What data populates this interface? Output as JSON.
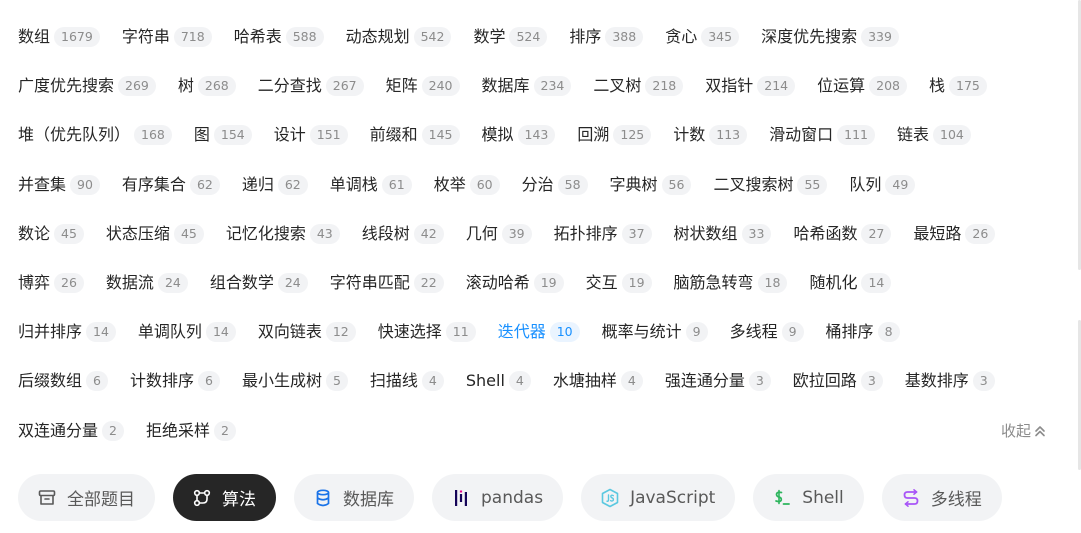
{
  "tag_rows": [
    [
      {
        "label": "数组",
        "count": "1679"
      },
      {
        "label": "字符串",
        "count": "718"
      },
      {
        "label": "哈希表",
        "count": "588"
      },
      {
        "label": "动态规划",
        "count": "542"
      },
      {
        "label": "数学",
        "count": "524"
      },
      {
        "label": "排序",
        "count": "388"
      },
      {
        "label": "贪心",
        "count": "345"
      },
      {
        "label": "深度优先搜索",
        "count": "339"
      }
    ],
    [
      {
        "label": "广度优先搜索",
        "count": "269"
      },
      {
        "label": "树",
        "count": "268"
      },
      {
        "label": "二分查找",
        "count": "267"
      },
      {
        "label": "矩阵",
        "count": "240"
      },
      {
        "label": "数据库",
        "count": "234"
      },
      {
        "label": "二叉树",
        "count": "218"
      },
      {
        "label": "双指针",
        "count": "214"
      },
      {
        "label": "位运算",
        "count": "208"
      },
      {
        "label": "栈",
        "count": "175"
      }
    ],
    [
      {
        "label": "堆（优先队列）",
        "count": "168"
      },
      {
        "label": "图",
        "count": "154"
      },
      {
        "label": "设计",
        "count": "151"
      },
      {
        "label": "前缀和",
        "count": "145"
      },
      {
        "label": "模拟",
        "count": "143"
      },
      {
        "label": "回溯",
        "count": "125"
      },
      {
        "label": "计数",
        "count": "113"
      },
      {
        "label": "滑动窗口",
        "count": "111"
      },
      {
        "label": "链表",
        "count": "104"
      }
    ],
    [
      {
        "label": "并查集",
        "count": "90"
      },
      {
        "label": "有序集合",
        "count": "62"
      },
      {
        "label": "递归",
        "count": "62"
      },
      {
        "label": "单调栈",
        "count": "61"
      },
      {
        "label": "枚举",
        "count": "60"
      },
      {
        "label": "分治",
        "count": "58"
      },
      {
        "label": "字典树",
        "count": "56"
      },
      {
        "label": "二叉搜索树",
        "count": "55"
      },
      {
        "label": "队列",
        "count": "49"
      }
    ],
    [
      {
        "label": "数论",
        "count": "45"
      },
      {
        "label": "状态压缩",
        "count": "45"
      },
      {
        "label": "记忆化搜索",
        "count": "43"
      },
      {
        "label": "线段树",
        "count": "42"
      },
      {
        "label": "几何",
        "count": "39"
      },
      {
        "label": "拓扑排序",
        "count": "37"
      },
      {
        "label": "树状数组",
        "count": "33"
      },
      {
        "label": "哈希函数",
        "count": "27"
      },
      {
        "label": "最短路",
        "count": "26"
      }
    ],
    [
      {
        "label": "博弈",
        "count": "26"
      },
      {
        "label": "数据流",
        "count": "24"
      },
      {
        "label": "组合数学",
        "count": "24"
      },
      {
        "label": "字符串匹配",
        "count": "22"
      },
      {
        "label": "滚动哈希",
        "count": "19"
      },
      {
        "label": "交互",
        "count": "19"
      },
      {
        "label": "脑筋急转弯",
        "count": "18"
      },
      {
        "label": "随机化",
        "count": "14"
      }
    ],
    [
      {
        "label": "归并排序",
        "count": "14"
      },
      {
        "label": "单调队列",
        "count": "14"
      },
      {
        "label": "双向链表",
        "count": "12"
      },
      {
        "label": "快速选择",
        "count": "11"
      },
      {
        "label": "迭代器",
        "count": "10",
        "selected": true
      },
      {
        "label": "概率与统计",
        "count": "9"
      },
      {
        "label": "多线程",
        "count": "9"
      },
      {
        "label": "桶排序",
        "count": "8"
      }
    ],
    [
      {
        "label": "后缀数组",
        "count": "6"
      },
      {
        "label": "计数排序",
        "count": "6"
      },
      {
        "label": "最小生成树",
        "count": "5"
      },
      {
        "label": "扫描线",
        "count": "4"
      },
      {
        "label": "Shell",
        "count": "4"
      },
      {
        "label": "水塘抽样",
        "count": "4"
      },
      {
        "label": "强连通分量",
        "count": "3"
      },
      {
        "label": "欧拉回路",
        "count": "3"
      },
      {
        "label": "基数排序",
        "count": "3"
      }
    ],
    [
      {
        "label": "双连通分量",
        "count": "2"
      },
      {
        "label": "拒绝采样",
        "count": "2"
      }
    ]
  ],
  "collapse_label": "收起",
  "categories": [
    {
      "label": "全部题目",
      "icon": "inbox-icon",
      "active": false
    },
    {
      "label": "算法",
      "icon": "algorithm-icon",
      "active": true
    },
    {
      "label": "数据库",
      "icon": "database-icon",
      "active": false
    },
    {
      "label": "pandas",
      "icon": "pandas-icon",
      "active": false
    },
    {
      "label": "JavaScript",
      "icon": "javascript-icon",
      "active": false
    },
    {
      "label": "Shell",
      "icon": "shell-icon",
      "active": false
    },
    {
      "label": "多线程",
      "icon": "concurrency-icon",
      "active": false
    }
  ],
  "colors": {
    "selected_tag": "#1890ff",
    "active_category_bg": "#262626",
    "database_icon": "#1a73e8",
    "pandas_icon": "#150458",
    "javascript_icon": "#5ac8e0",
    "shell_icon": "#2db55d",
    "concurrency_icon": "#a855f7"
  }
}
